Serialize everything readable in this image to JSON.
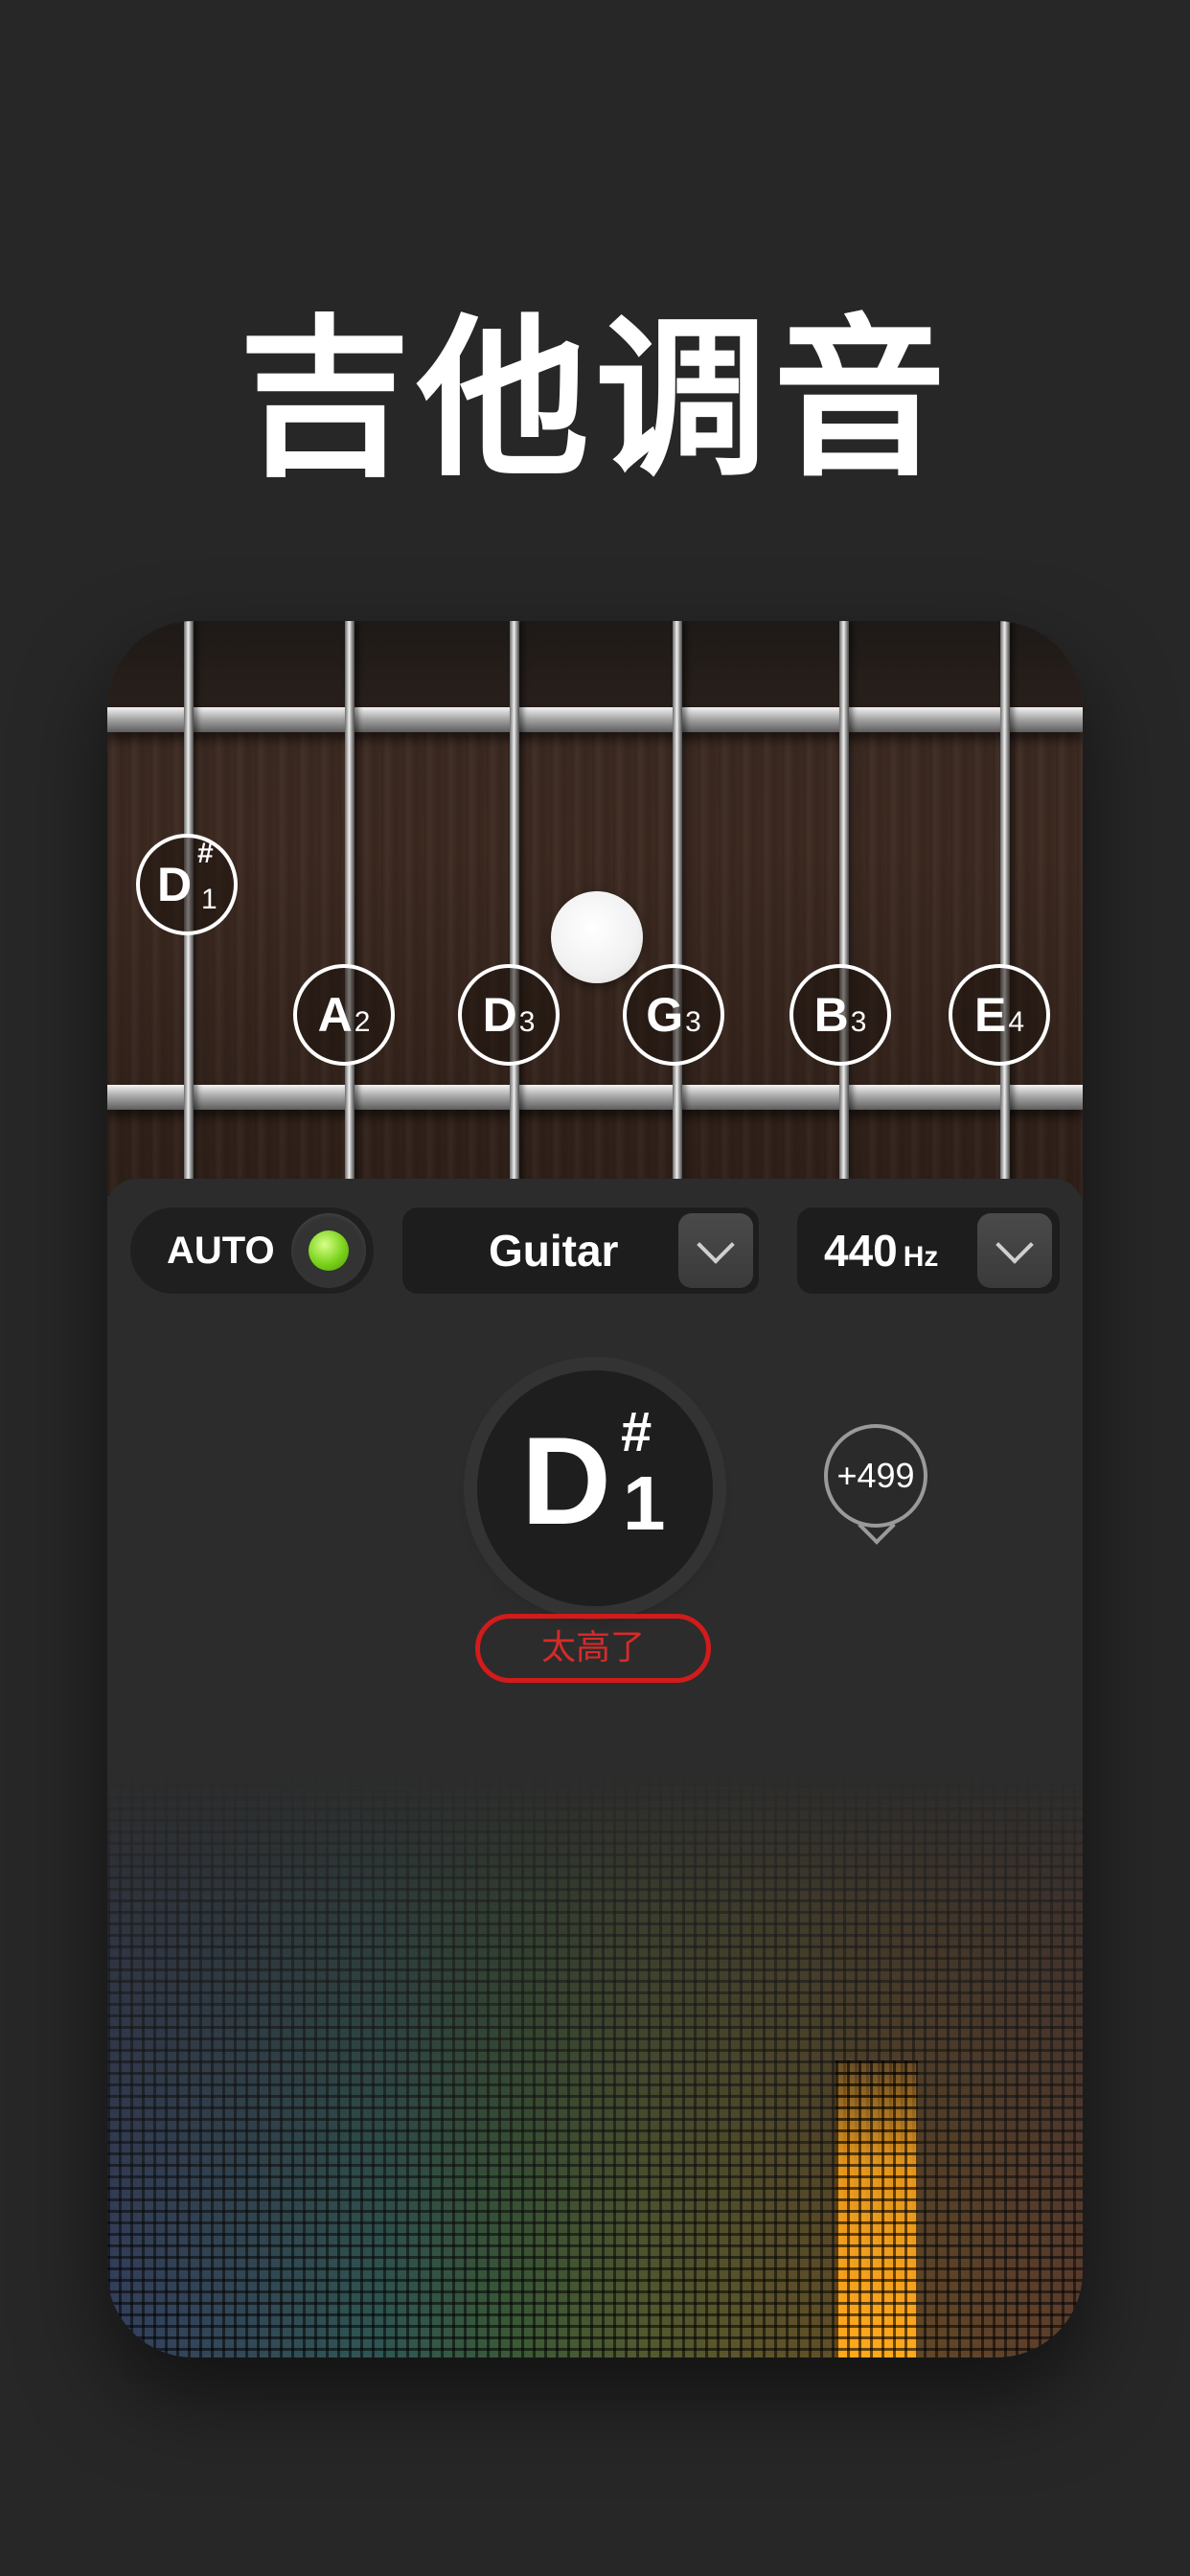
{
  "headline": "吉他调音",
  "strings": [
    {
      "note": "A",
      "octave": "2"
    },
    {
      "note": "D",
      "octave": "3"
    },
    {
      "note": "G",
      "octave": "3"
    },
    {
      "note": "B",
      "octave": "3"
    },
    {
      "note": "E",
      "octave": "4"
    }
  ],
  "detected_marker": {
    "note": "D",
    "accidental": "#",
    "octave": "1"
  },
  "controls": {
    "auto_label": "AUTO",
    "auto_on": true,
    "instrument": "Guitar",
    "reference_value": "440",
    "reference_unit": "Hz"
  },
  "tuner": {
    "note": "D",
    "accidental": "#",
    "octave": "1",
    "status": "太高了",
    "cents": "+499"
  },
  "colors": {
    "auto_led": "#7ad21a",
    "status": "#d21b1b",
    "peak": "#ffa81c"
  }
}
